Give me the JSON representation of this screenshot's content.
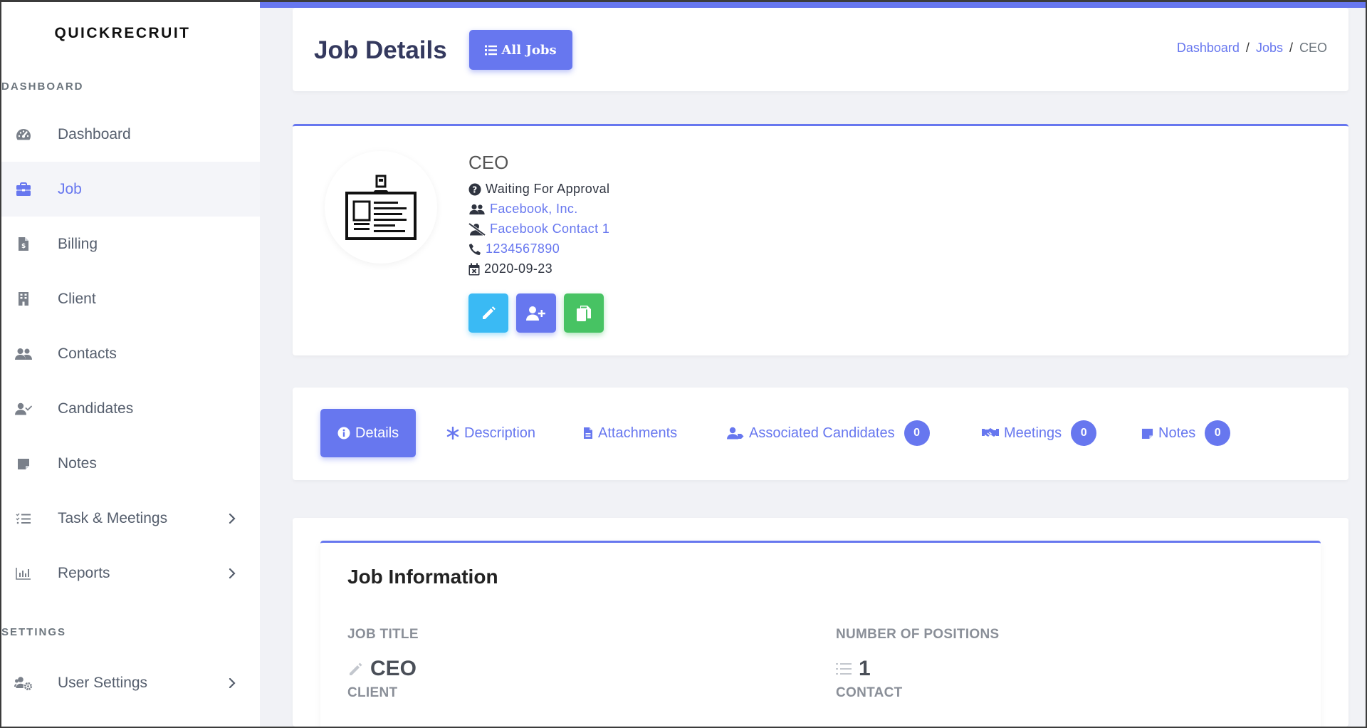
{
  "brand": {
    "name": "QUICKRECRUIT"
  },
  "sidebar": {
    "section_dashboard": "DASHBOARD",
    "section_settings": "SETTINGS",
    "items": [
      {
        "label": "Dashboard",
        "icon": "gauge-icon",
        "active": false,
        "has_submenu": false
      },
      {
        "label": "Job",
        "icon": "briefcase-icon",
        "active": true,
        "has_submenu": false
      },
      {
        "label": "Billing",
        "icon": "invoice-icon",
        "active": false,
        "has_submenu": false
      },
      {
        "label": "Client",
        "icon": "building-icon",
        "active": false,
        "has_submenu": false
      },
      {
        "label": "Contacts",
        "icon": "users-icon",
        "active": false,
        "has_submenu": false
      },
      {
        "label": "Candidates",
        "icon": "user-check-icon",
        "active": false,
        "has_submenu": false
      },
      {
        "label": "Notes",
        "icon": "sticky-note-icon",
        "active": false,
        "has_submenu": false
      },
      {
        "label": "Task & Meetings",
        "icon": "tasks-icon",
        "active": false,
        "has_submenu": true
      },
      {
        "label": "Reports",
        "icon": "chart-icon",
        "active": false,
        "has_submenu": true
      },
      {
        "label": "User Settings",
        "icon": "users-cog-icon",
        "active": false,
        "has_submenu": true
      }
    ]
  },
  "header": {
    "title": "Job Details",
    "all_jobs_label": "All Jobs",
    "breadcrumb": [
      "Dashboard",
      "Jobs",
      "CEO"
    ]
  },
  "job": {
    "title": "CEO",
    "status": "Waiting For Approval",
    "company": "Facebook, Inc.",
    "contact": "Facebook Contact 1",
    "phone": "1234567890",
    "date": "2020-09-23",
    "actions": [
      "edit-button",
      "add-candidate-button",
      "copy-button"
    ]
  },
  "tabs": [
    {
      "label": "Details",
      "icon": "info-circle-icon",
      "active": true
    },
    {
      "label": "Description",
      "icon": "asterisk-icon",
      "active": false
    },
    {
      "label": "Attachments",
      "icon": "file-icon",
      "active": false
    },
    {
      "label": "Associated Candidates",
      "icon": "user-tag-icon",
      "active": false,
      "count": "0"
    },
    {
      "label": "Meetings",
      "icon": "handshake-icon",
      "active": false,
      "count": "0"
    },
    {
      "label": "Notes",
      "icon": "sticky-note-icon",
      "active": false,
      "count": "0"
    }
  ],
  "job_information": {
    "heading": "Job Information",
    "fields": [
      {
        "label": "JOB TITLE",
        "value": "CEO",
        "icon": "pen-icon"
      },
      {
        "label": "NUMBER OF POSITIONS",
        "value": "1",
        "icon": "list-icon"
      },
      {
        "label": "CLIENT"
      },
      {
        "label": "CONTACT"
      }
    ]
  },
  "colors": {
    "primary": "#6777ef",
    "info": "#3abaf4",
    "success": "#47c363",
    "background": "#f1f2f6"
  }
}
